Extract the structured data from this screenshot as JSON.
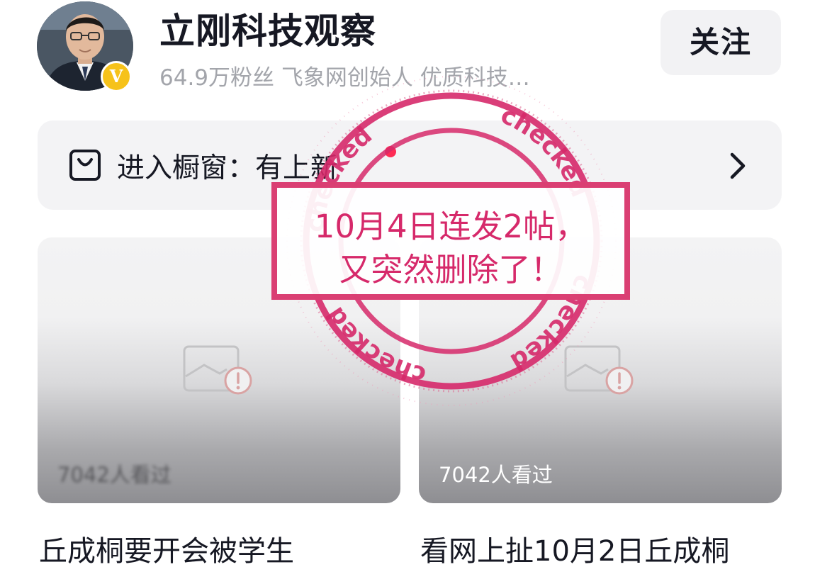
{
  "profile": {
    "name": "立刚科技观察",
    "subtitle": "64.9万粉丝  飞象网创始人 优质科技…",
    "badge": "V",
    "follow_label": "关注"
  },
  "shop": {
    "label": "进入橱窗：有上新",
    "icon": "shopping-bag-icon",
    "has_new_dot": true
  },
  "videos": [
    {
      "views": "7042人看过",
      "title": "丘成桐要开会被学生",
      "thumbnail": "broken-image-icon"
    },
    {
      "views": "7042人看过",
      "title": "看网上扯10月2日丘成桐",
      "thumbnail": "broken-image-icon"
    }
  ],
  "stamp": {
    "ring_text": "checked",
    "line1": "10月4日连发2帖，",
    "line2": "又突然删除了！",
    "color": "#d6296a"
  },
  "colors": {
    "text_primary": "#161823",
    "text_secondary": "#a3a5ab",
    "badge_gold": "#f6c21a",
    "new_dot": "#fe2c55",
    "panel_bg": "#f3f3f5"
  }
}
